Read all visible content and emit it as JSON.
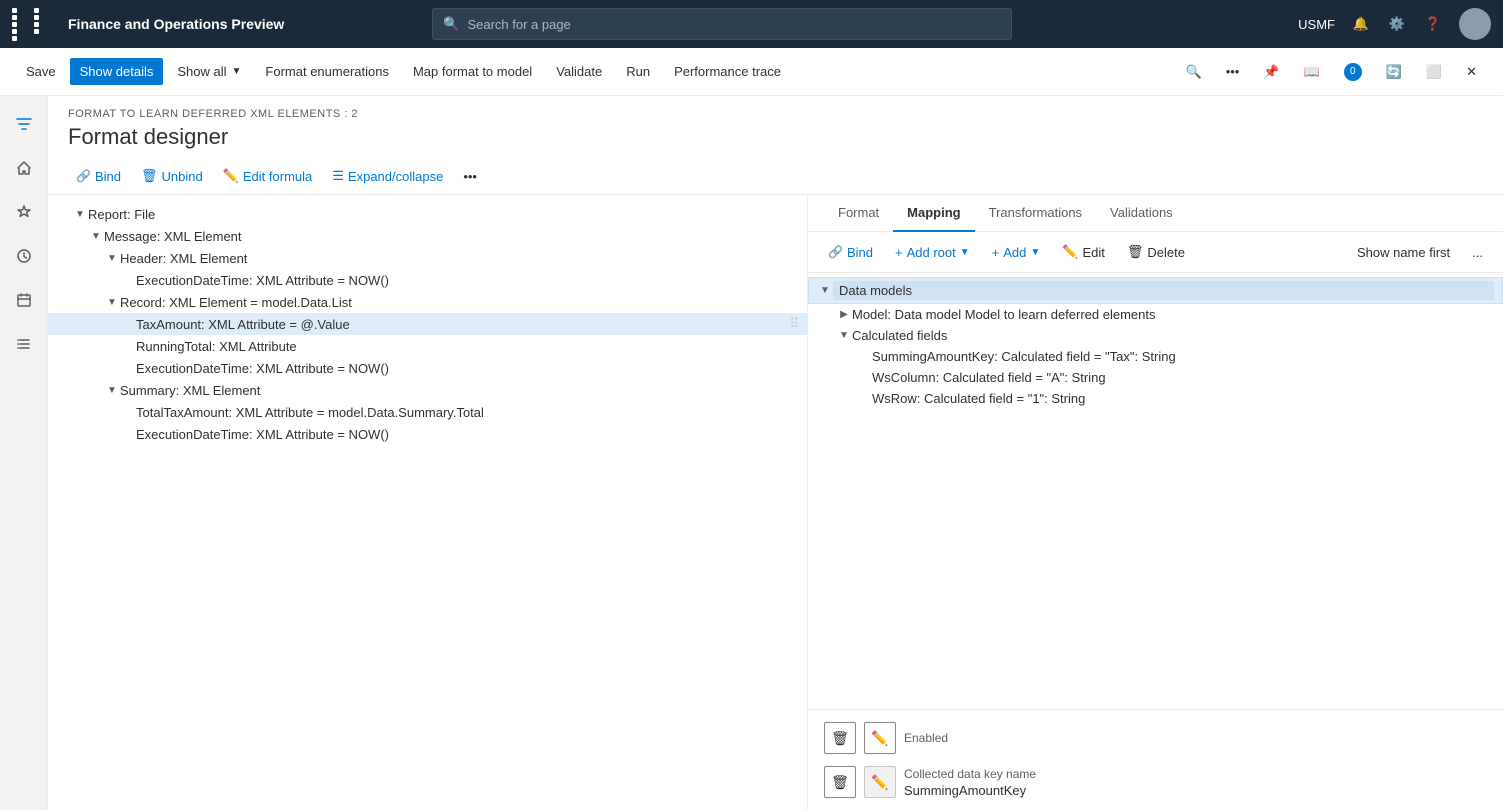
{
  "topbar": {
    "app_title": "Finance and Operations Preview",
    "search_placeholder": "Search for a page",
    "user_name": "USMF"
  },
  "cmdbar": {
    "save_label": "Save",
    "show_details_label": "Show details",
    "show_all_label": "Show all",
    "format_enum_label": "Format enumerations",
    "map_format_label": "Map format to model",
    "validate_label": "Validate",
    "run_label": "Run",
    "perf_trace_label": "Performance trace"
  },
  "page": {
    "subtitle": "FORMAT TO LEARN DEFERRED XML ELEMENTS : 2",
    "title": "Format designer"
  },
  "toolbar": {
    "bind_label": "Bind",
    "unbind_label": "Unbind",
    "edit_formula_label": "Edit formula",
    "expand_label": "Expand/collapse",
    "more_label": "..."
  },
  "tree": {
    "items": [
      {
        "id": "report",
        "indent": 1,
        "label": "Report: File",
        "chevron": "▼",
        "selected": false
      },
      {
        "id": "message",
        "indent": 2,
        "label": "Message: XML Element",
        "chevron": "▼",
        "selected": false
      },
      {
        "id": "header",
        "indent": 3,
        "label": "Header: XML Element",
        "chevron": "▼",
        "selected": false
      },
      {
        "id": "execdate1",
        "indent": 4,
        "label": "ExecutionDateTime: XML Attribute = NOW()",
        "chevron": "",
        "selected": false
      },
      {
        "id": "record",
        "indent": 3,
        "label": "Record: XML Element = model.Data.List",
        "chevron": "▼",
        "selected": false
      },
      {
        "id": "taxamount",
        "indent": 4,
        "label": "TaxAmount: XML Attribute = @.Value",
        "chevron": "",
        "selected": true
      },
      {
        "id": "runningtotal",
        "indent": 4,
        "label": "RunningTotal: XML Attribute",
        "chevron": "",
        "selected": false
      },
      {
        "id": "execdate2",
        "indent": 4,
        "label": "ExecutionDateTime: XML Attribute = NOW()",
        "chevron": "",
        "selected": false
      },
      {
        "id": "summary",
        "indent": 3,
        "label": "Summary: XML Element",
        "chevron": "▼",
        "selected": false
      },
      {
        "id": "totaltax",
        "indent": 4,
        "label": "TotalTaxAmount: XML Attribute = model.Data.Summary.Total",
        "chevron": "",
        "selected": false
      },
      {
        "id": "execdate3",
        "indent": 4,
        "label": "ExecutionDateTime: XML Attribute = NOW()",
        "chevron": "",
        "selected": false
      }
    ]
  },
  "mapping": {
    "tabs": [
      {
        "id": "format",
        "label": "Format",
        "active": false
      },
      {
        "id": "mapping",
        "label": "Mapping",
        "active": true
      },
      {
        "id": "transformations",
        "label": "Transformations",
        "active": false
      },
      {
        "id": "validations",
        "label": "Validations",
        "active": false
      }
    ],
    "toolbar": {
      "bind_label": "Bind",
      "add_root_label": "Add root",
      "add_label": "Add",
      "edit_label": "Edit",
      "delete_label": "Delete",
      "show_name_first_label": "Show name first",
      "more_label": "..."
    },
    "tree": {
      "items": [
        {
          "id": "data-models",
          "indent": 0,
          "label": "Data models",
          "chevron": "▼",
          "selected": true
        },
        {
          "id": "model-root",
          "indent": 1,
          "label": "Model: Data model Model to learn deferred elements",
          "chevron": "▶",
          "selected": false
        },
        {
          "id": "calc-fields",
          "indent": 1,
          "label": "Calculated fields",
          "chevron": "▼",
          "selected": false
        },
        {
          "id": "summing",
          "indent": 2,
          "label": "SummingAmountKey: Calculated field = \"Tax\": String",
          "chevron": "",
          "selected": false
        },
        {
          "id": "wscol",
          "indent": 2,
          "label": "WsColumn: Calculated field = \"A\": String",
          "chevron": "",
          "selected": false
        },
        {
          "id": "wsrow",
          "indent": 2,
          "label": "WsRow: Calculated field = \"1\": String",
          "chevron": "",
          "selected": false
        }
      ]
    },
    "properties": [
      {
        "id": "prop1",
        "label": "Enabled",
        "value": ""
      },
      {
        "id": "prop2",
        "label": "Collected data key name",
        "value": "SummingAmountKey"
      }
    ]
  }
}
